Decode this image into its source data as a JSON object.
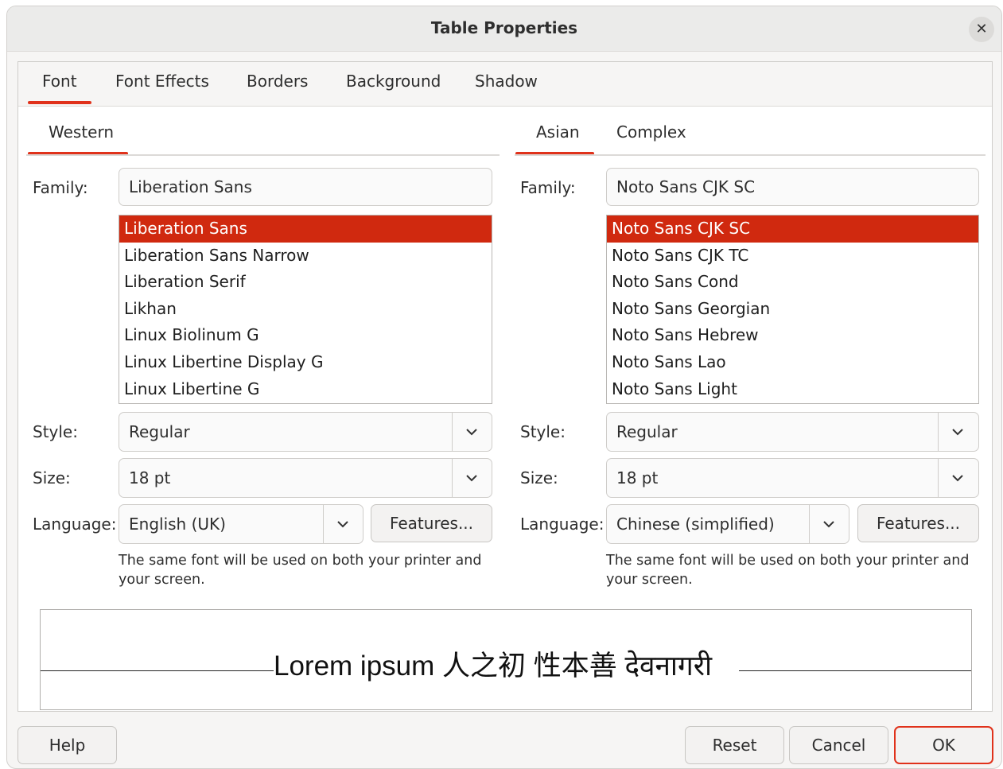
{
  "window": {
    "title": "Table Properties",
    "close_glyph": "✕"
  },
  "tabs": [
    "Font",
    "Font Effects",
    "Borders",
    "Background",
    "Shadow"
  ],
  "western": {
    "tab_label": "Western",
    "family_label": "Family:",
    "family_value": "Liberation Sans",
    "fonts": [
      "Liberation Sans",
      "Liberation Sans Narrow",
      "Liberation Serif",
      "Likhan",
      "Linux Biolinum G",
      "Linux Libertine Display G",
      "Linux Libertine G"
    ],
    "style_label": "Style:",
    "style_value": "Regular",
    "size_label": "Size:",
    "size_value": "18 pt",
    "language_label": "Language:",
    "language_value": "English (UK)",
    "features_label": "Features...",
    "note": "The same font will be used on both your printer and your screen."
  },
  "asian": {
    "tab_label": "Asian",
    "complex_tab_label": "Complex",
    "family_label": "Family:",
    "family_value": "Noto Sans CJK SC",
    "fonts": [
      "Noto Sans CJK SC",
      "Noto Sans CJK TC",
      "Noto Sans Cond",
      "Noto Sans Georgian",
      "Noto Sans Hebrew",
      "Noto Sans Lao",
      "Noto Sans Light"
    ],
    "style_label": "Style:",
    "style_value": "Regular",
    "size_label": "Size:",
    "size_value": "18 pt",
    "language_label": "Language:",
    "language_value": "Chinese (simplified)",
    "features_label": "Features...",
    "note": "The same font will be used on both your printer and your screen."
  },
  "preview": {
    "text": "Lorem ipsum   人之初 性本善  देवनागरी"
  },
  "footer": {
    "help": "Help",
    "reset": "Reset",
    "cancel": "Cancel",
    "ok": "OK"
  },
  "colors": {
    "accent": "#e0321b",
    "selection": "#d0290f"
  }
}
